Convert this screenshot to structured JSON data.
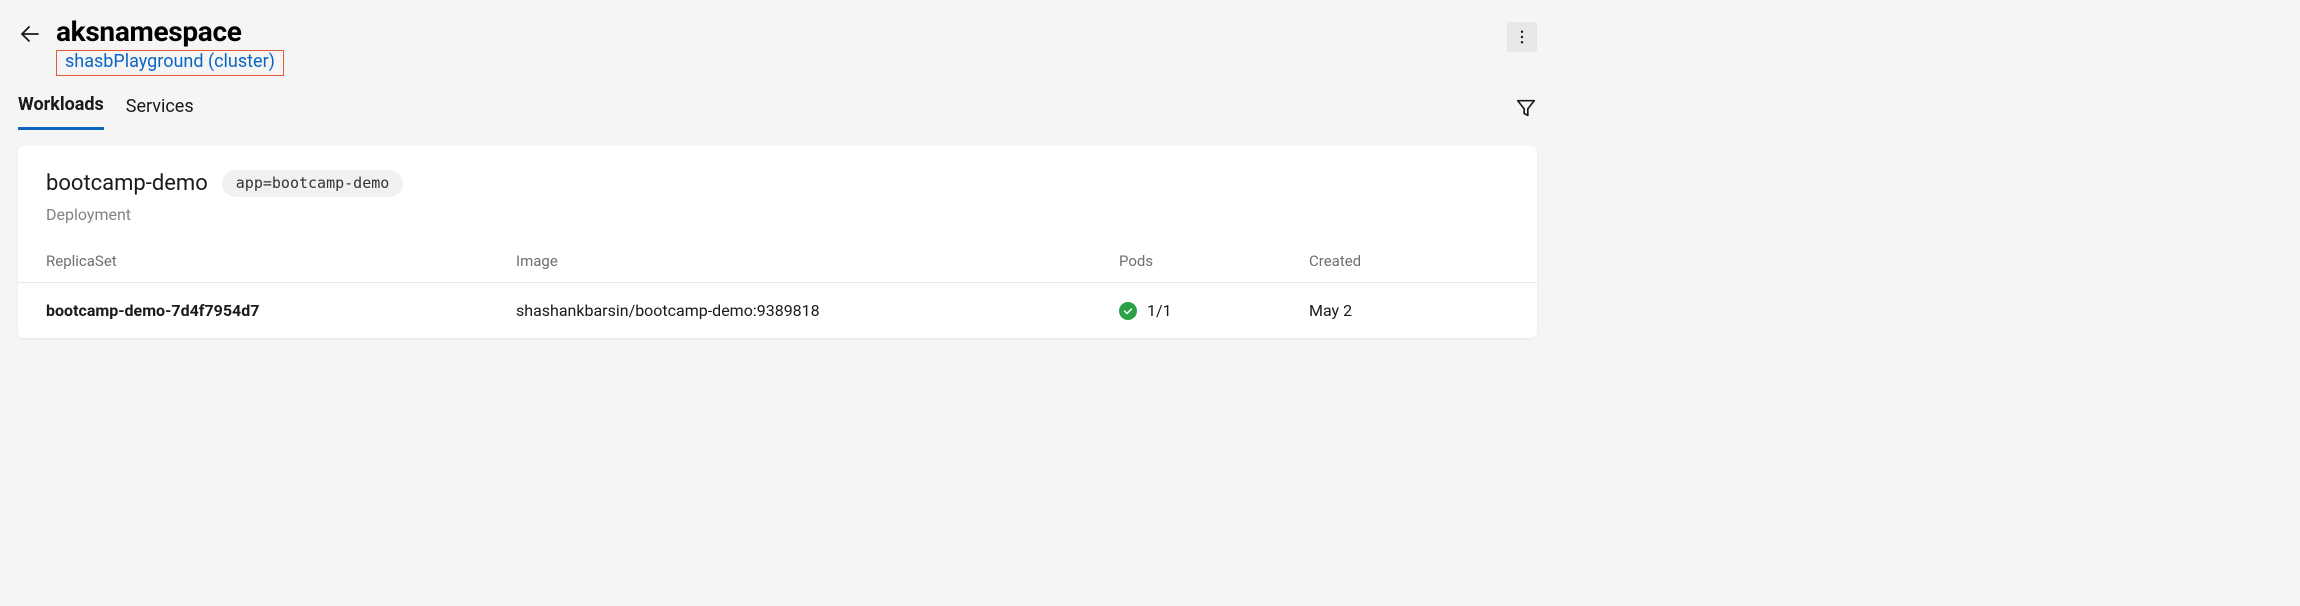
{
  "header": {
    "title": "aksnamespace",
    "breadcrumb_link": "shasbPlayground (cluster)"
  },
  "tabs": {
    "workloads": "Workloads",
    "services": "Services"
  },
  "workload": {
    "name": "bootcamp-demo",
    "tag": "app=bootcamp-demo",
    "kind": "Deployment"
  },
  "columns": {
    "replicaset": "ReplicaSet",
    "image": "Image",
    "pods": "Pods",
    "created": "Created"
  },
  "rows": [
    {
      "name": "bootcamp-demo-7d4f7954d7",
      "image": "shashankbarsin/bootcamp-demo:9389818",
      "pods": "1/1",
      "created": "May 2",
      "status": "ok"
    }
  ]
}
